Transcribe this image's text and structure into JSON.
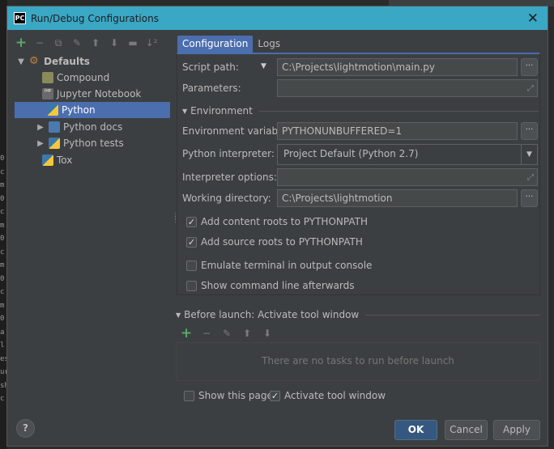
{
  "window": {
    "title": "Run/Debug Configurations"
  },
  "background": {
    "left_chars": [
      "0",
      "c",
      "m",
      "0",
      "c",
      "m",
      "0",
      "c",
      "m",
      "0",
      "c",
      "m",
      "0",
      "a",
      "l",
      "es",
      "ur",
      "sh",
      "c"
    ]
  },
  "toolbar": {
    "icons": [
      "add-icon",
      "remove-icon",
      "copy-icon",
      "wrench-icon",
      "move-up-icon",
      "move-down-icon",
      "folder-icon",
      "sort-icon"
    ]
  },
  "tree": {
    "root": {
      "label": "Defaults"
    },
    "items": [
      {
        "label": "Compound"
      },
      {
        "label": "Jupyter Notebook"
      },
      {
        "label": "Python"
      },
      {
        "label": "Python docs"
      },
      {
        "label": "Python tests"
      },
      {
        "label": "Tox"
      }
    ]
  },
  "tabs": [
    {
      "label": "Configuration"
    },
    {
      "label": "Logs"
    }
  ],
  "form": {
    "script_path_label": "Script path:",
    "script_path_value": "C:\\Projects\\lightmotion\\main.py",
    "parameters_label": "Parameters:",
    "parameters_value": "",
    "environment_section": "Environment",
    "env_vars_label": "Environment variables:",
    "env_vars_value": "PYTHONUNBUFFERED=1",
    "interpreter_label": "Python interpreter:",
    "interpreter_value": "Project Default (Python 2.7)",
    "interpreter_options_label": "Interpreter options:",
    "interpreter_options_value": "",
    "working_dir_label": "Working directory:",
    "working_dir_value": "C:\\Projects\\lightmotion",
    "dots": "···",
    "checkboxes": [
      {
        "label": "Add content roots to PYTHONPATH",
        "checked": true
      },
      {
        "label": "Add source roots to PYTHONPATH",
        "checked": true
      },
      {
        "label": "Emulate terminal in output console",
        "checked": false
      },
      {
        "label": "Show command line afterwards",
        "checked": false
      }
    ]
  },
  "before_launch": {
    "title": "Before launch: Activate tool window",
    "empty_text": "There are no tasks to run before launch"
  },
  "footer": {
    "show_page_label": "Show this page",
    "show_page_checked": false,
    "activate_label": "Activate tool window",
    "activate_checked": true,
    "ok": "OK",
    "cancel": "Cancel",
    "apply": "Apply",
    "help": "?"
  },
  "colors": {
    "accent": "#4b6eaf",
    "titlebar": "#3aa7c4",
    "background": "#3c3f41",
    "add_green": "#59a869"
  }
}
